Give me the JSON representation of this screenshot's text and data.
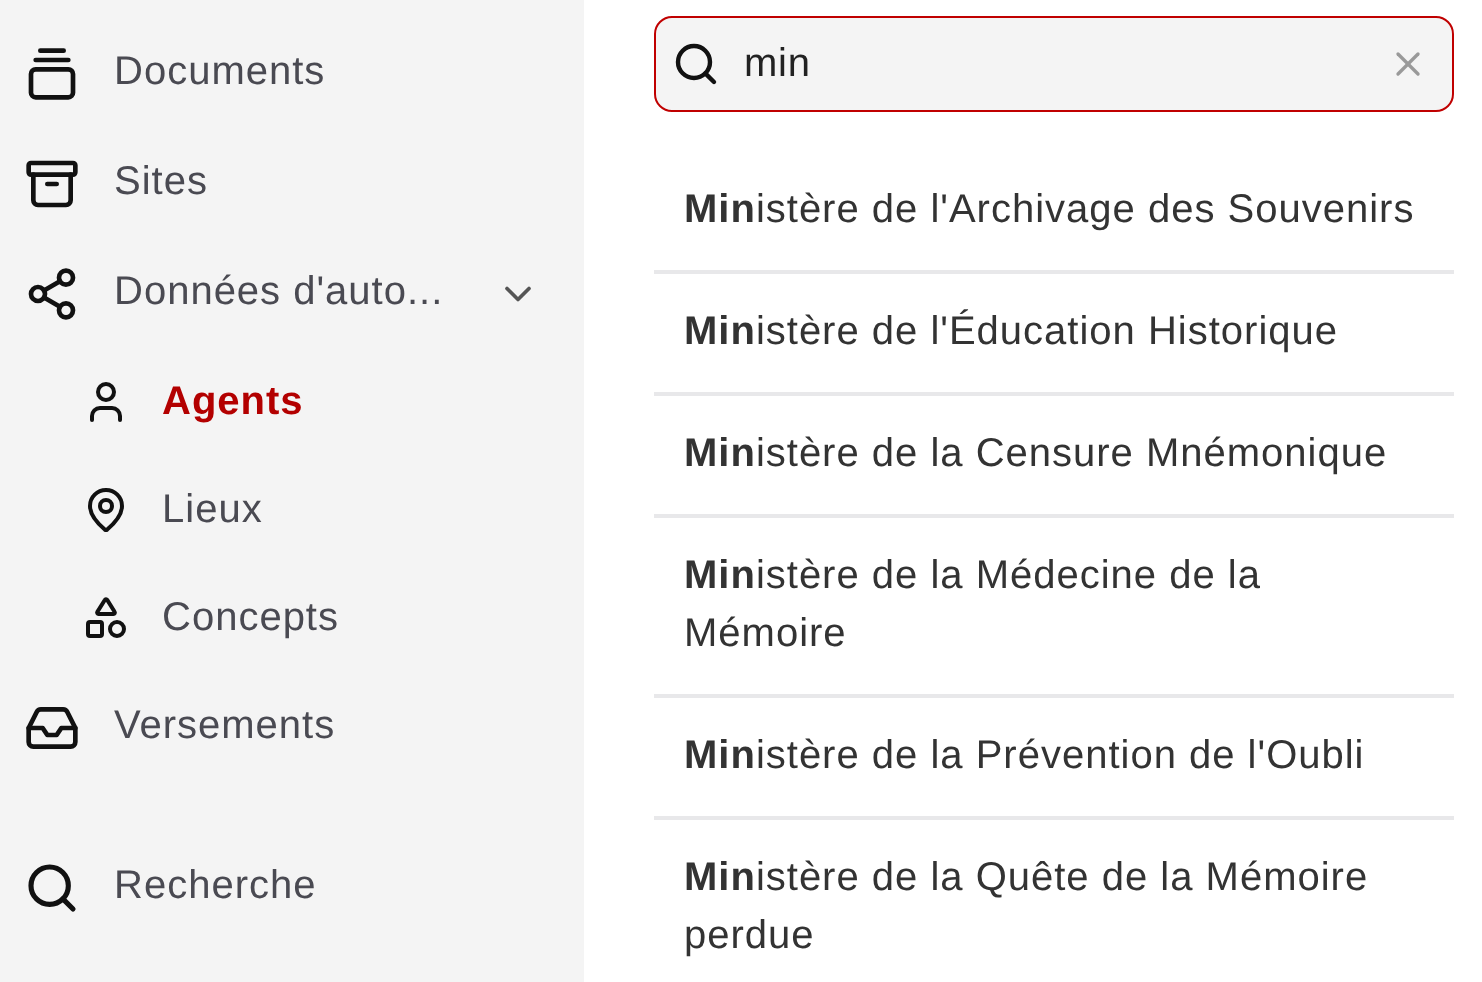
{
  "sidebar": {
    "items": [
      {
        "label": "Documents",
        "selected": false
      },
      {
        "label": "Sites",
        "selected": false
      },
      {
        "label": "Données d'auto...",
        "selected": false,
        "expanded": true,
        "children": [
          {
            "label": "Agents",
            "selected": true
          },
          {
            "label": "Lieux",
            "selected": false
          },
          {
            "label": "Concepts",
            "selected": false
          }
        ]
      },
      {
        "label": "Versements",
        "selected": false
      }
    ],
    "footer_items": [
      {
        "label": "Recherche",
        "selected": false
      }
    ]
  },
  "search": {
    "value": "min"
  },
  "results": [
    {
      "text": "**Min**istère de l'Archivage des Souvenirs"
    },
    {
      "text": "**Min**istère de l'Éducation Historique"
    },
    {
      "text": "**Min**istère de la Censure Mnémonique"
    },
    {
      "text": "**Min**istère de la Médecine de la Mémoire"
    },
    {
      "text": "**Min**istère de la Prévention de l'Oubli"
    },
    {
      "text": "**Min**istère de la Quête de la Mémoire perdue"
    }
  ]
}
